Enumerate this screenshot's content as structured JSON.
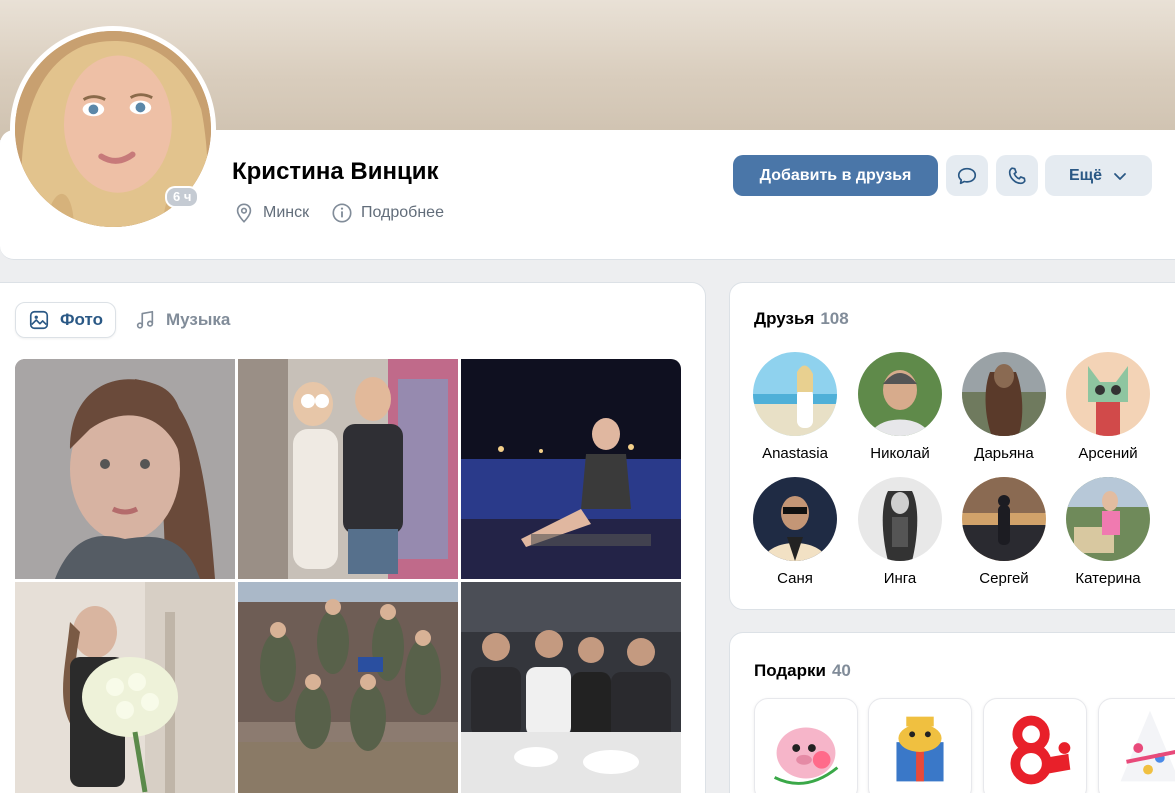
{
  "profile": {
    "name": "Кристина Винцик",
    "online_badge": "6 ч",
    "city": "Минск",
    "details_label": "Подробнее"
  },
  "actions": {
    "add_friend": "Добавить в друзья",
    "message_icon": "message-icon",
    "call_icon": "phone-icon",
    "more": "Ещё"
  },
  "media": {
    "tabs": [
      {
        "label": "Фото",
        "icon": "photo-icon",
        "active": true
      },
      {
        "label": "Музыка",
        "icon": "music-note-icon",
        "active": false
      }
    ]
  },
  "friends": {
    "title": "Друзья",
    "count": "108",
    "items": [
      {
        "name": "Anastasia"
      },
      {
        "name": "Николай"
      },
      {
        "name": "Дарьяна"
      },
      {
        "name": "Арсений"
      },
      {
        "name": "Саня"
      },
      {
        "name": "Инга"
      },
      {
        "name": "Сергей"
      },
      {
        "name": "Катерина"
      }
    ]
  },
  "gifts": {
    "title": "Подарки",
    "count": "40"
  },
  "colors": {
    "accent": "#4a76a8",
    "link": "#2a5885",
    "secondary_text": "#818c99",
    "page_background": "#edeef0"
  }
}
